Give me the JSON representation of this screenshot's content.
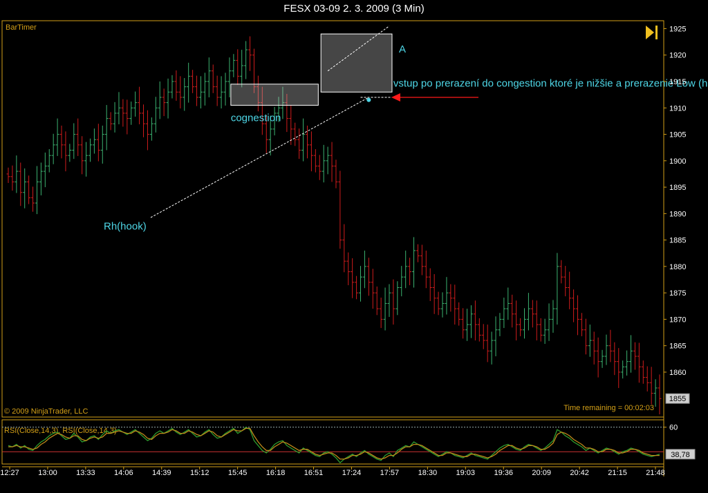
{
  "window": {
    "title": "FESX 03-09  2. 3. 2009 (3 Min)"
  },
  "panel": {
    "bartimer_label": "BarTimer",
    "copyright": "© 2009 NinjaTrader, LLC",
    "time_remaining": "Time remaining = 00:02:03",
    "play_icon": "skip-forward-icon"
  },
  "annotations": {
    "label_a": "A",
    "cognestion": "cognestion",
    "rh_hook": "Rh(hook)",
    "entry_note": "vstup po prerazení do congestion ktoré je nižšie a prerazenie Low (hook)"
  },
  "colors": {
    "up_bar": "#3cb371",
    "down_bar": "#d01c1c",
    "axis": "#d4a017",
    "annotation_text": "#4ed6e6",
    "rsi_line_1": "#2e9e2e",
    "rsi_line_2": "#c08a1a"
  },
  "chart_data": [
    {
      "type": "ohlc",
      "y_ticks": [
        1925,
        1920,
        1915,
        1910,
        1905,
        1900,
        1895,
        1890,
        1885,
        1880,
        1875,
        1870,
        1865,
        1860
      ],
      "ylim": [
        1851.5,
        1926.5
      ],
      "x_tick_labels": [
        "12:27",
        "13:00",
        "13:33",
        "14:06",
        "14:39",
        "15:12",
        "15:45",
        "16:18",
        "16:51",
        "17:24",
        "17:57",
        "18:30",
        "19:03",
        "19:36",
        "20:09",
        "20:42",
        "21:15",
        "21:48"
      ],
      "last_price_label": "1855",
      "closes": [
        1897,
        1896,
        1898,
        1894,
        1896,
        1893,
        1892,
        1896,
        1898,
        1899,
        1901,
        1903,
        1905,
        1903,
        1901,
        1902,
        1905,
        1903,
        1900,
        1901,
        1903,
        1904,
        1902,
        1905,
        1908,
        1907,
        1909,
        1910,
        1909,
        1908,
        1910,
        1911,
        1909,
        1907,
        1905,
        1907,
        1910,
        1912,
        1911,
        1913,
        1915,
        1913,
        1912,
        1914,
        1916,
        1914,
        1912,
        1913,
        1915,
        1917,
        1914,
        1912,
        1913,
        1915,
        1917,
        1919,
        1916,
        1918,
        1921,
        1920,
        1914,
        1911,
        1907,
        1904,
        1906,
        1909,
        1910,
        1911,
        1908,
        1906,
        1904,
        1902,
        1905,
        1903,
        1901,
        1899,
        1898,
        1900,
        1901,
        1899,
        1896,
        1885,
        1881,
        1879,
        1877,
        1875,
        1878,
        1880,
        1877,
        1875,
        1872,
        1870,
        1873,
        1875,
        1872,
        1876,
        1878,
        1880,
        1879,
        1883,
        1882,
        1880,
        1878,
        1876,
        1874,
        1872,
        1873,
        1875,
        1874,
        1872,
        1870,
        1868,
        1869,
        1871,
        1869,
        1867,
        1866,
        1864,
        1866,
        1868,
        1870,
        1872,
        1873,
        1871,
        1869,
        1868,
        1870,
        1872,
        1871,
        1869,
        1867,
        1868,
        1870,
        1872,
        1880,
        1878,
        1876,
        1874,
        1872,
        1870,
        1868,
        1865,
        1866,
        1864,
        1862,
        1863,
        1865,
        1864,
        1862,
        1860,
        1861,
        1862,
        1864,
        1863,
        1861,
        1859,
        1858,
        1856,
        1857,
        1855
      ],
      "annotations": [
        "A",
        "cognestion",
        "Rh(hook)",
        "vstup po prerazení do congestion ktoré je nižšie a prerazenie Low (hook)"
      ]
    },
    {
      "type": "line",
      "title": "RSI(Close,14,3), RSI(Close,14,3)",
      "y_ticks": [
        60
      ],
      "ylim": [
        30,
        66
      ],
      "last_value_label": "38,78",
      "series": [
        {
          "name": "RSI(Close,14,3)",
          "values": [
            45,
            44,
            46,
            43,
            45,
            42,
            41,
            45,
            48,
            50,
            53,
            55,
            56,
            53,
            50,
            51,
            55,
            52,
            48,
            49,
            52,
            53,
            50,
            54,
            57,
            55,
            57,
            58,
            56,
            54,
            56,
            58,
            55,
            52,
            49,
            51,
            55,
            57,
            55,
            57,
            59,
            56,
            54,
            56,
            58,
            55,
            52,
            53,
            56,
            58,
            54,
            51,
            52,
            55,
            57,
            59,
            55,
            57,
            60,
            58,
            49,
            45,
            41,
            39,
            42,
            46,
            48,
            49,
            45,
            43,
            41,
            39,
            43,
            41,
            39,
            37,
            36,
            39,
            40,
            38,
            35,
            31,
            34,
            36,
            38,
            36,
            39,
            41,
            38,
            36,
            34,
            33,
            37,
            39,
            36,
            41,
            43,
            45,
            44,
            48,
            46,
            44,
            42,
            40,
            38,
            36,
            38,
            40,
            39,
            37,
            36,
            35,
            37,
            39,
            37,
            36,
            35,
            34,
            37,
            40,
            43,
            45,
            46,
            44,
            42,
            41,
            44,
            46,
            45,
            43,
            41,
            43,
            46,
            49,
            58,
            56,
            53,
            51,
            48,
            46,
            44,
            41,
            43,
            41,
            39,
            41,
            43,
            42,
            40,
            38,
            40,
            41,
            43,
            42,
            40,
            38,
            37,
            36,
            37,
            38
          ]
        },
        {
          "name": "RSI(Close,14,3)",
          "values": [
            44,
            44,
            45,
            44,
            44,
            43,
            42,
            43,
            46,
            48,
            51,
            53,
            55,
            54,
            52,
            51,
            53,
            53,
            50,
            49,
            51,
            52,
            51,
            52,
            55,
            55,
            56,
            57,
            56,
            55,
            55,
            57,
            56,
            54,
            51,
            50,
            53,
            55,
            55,
            56,
            58,
            57,
            55,
            55,
            57,
            56,
            54,
            53,
            55,
            57,
            56,
            53,
            52,
            54,
            56,
            58,
            57,
            57,
            59,
            59,
            53,
            48,
            44,
            41,
            41,
            44,
            46,
            48,
            47,
            45,
            43,
            41,
            42,
            42,
            40,
            38,
            37,
            38,
            39,
            39,
            37,
            34,
            34,
            35,
            37,
            37,
            38,
            40,
            39,
            37,
            35,
            34,
            35,
            37,
            37,
            39,
            42,
            44,
            44,
            46,
            46,
            45,
            43,
            41,
            39,
            37,
            37,
            39,
            39,
            38,
            37,
            36,
            36,
            38,
            38,
            37,
            36,
            35,
            36,
            38,
            41,
            43,
            45,
            45,
            43,
            42,
            43,
            45,
            45,
            44,
            42,
            42,
            44,
            47,
            54,
            56,
            55,
            53,
            50,
            48,
            46,
            43,
            43,
            42,
            40,
            40,
            42,
            42,
            41,
            39,
            39,
            40,
            42,
            42,
            41,
            39,
            38,
            37,
            37,
            37
          ]
        }
      ]
    }
  ]
}
